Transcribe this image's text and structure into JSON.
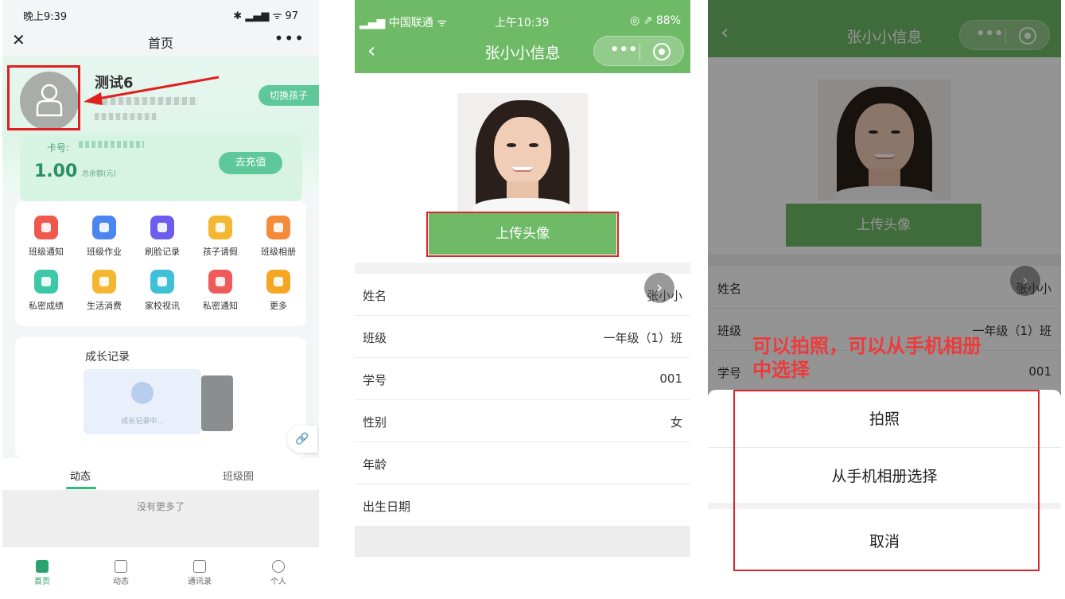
{
  "panel1": {
    "status_time": "晚上9:39",
    "status_right": "✱ ▂▄▆ ᯤ 97",
    "nav_title": "首页",
    "profile_name": "测试6",
    "switch_child": "切换孩子",
    "card_label": "卡号:",
    "balance": "1.00",
    "balance_label": "总余额(元)",
    "recharge": "去充值",
    "features": [
      {
        "label": "班级通知",
        "color": "#f0584e"
      },
      {
        "label": "班级作业",
        "color": "#4b86f0"
      },
      {
        "label": "刷脸记录",
        "color": "#6c5df0"
      },
      {
        "label": "孩子请假",
        "color": "#f5b731"
      },
      {
        "label": "班级相册",
        "color": "#f58a3a"
      },
      {
        "label": "私密成绩",
        "color": "#3dc9a8"
      },
      {
        "label": "生活消费",
        "color": "#f5b731"
      },
      {
        "label": "家校视讯",
        "color": "#3ec0d8"
      },
      {
        "label": "私密通知",
        "color": "#f05a5a"
      },
      {
        "label": "更多",
        "color": "#f5a623"
      }
    ],
    "growth_title": "成长记录",
    "growth_empty": "成长记录中...",
    "tabs": [
      "动态",
      "班级圈"
    ],
    "no_more": "没有更多了",
    "bottom_nav": [
      "首页",
      "动态",
      "通讯录",
      "个人"
    ]
  },
  "panel2": {
    "carrier": "▂▄▆ 中国联通 ᯤ",
    "time": "上午10:39",
    "battery": "◎ ⇗ 88%",
    "title": "张小小信息",
    "upload": "上传头像",
    "rows": [
      {
        "key": "姓名",
        "value": "张小小"
      },
      {
        "key": "班级",
        "value": "一年级（1）班"
      },
      {
        "key": "学号",
        "value": "001"
      },
      {
        "key": "性别",
        "value": "女"
      },
      {
        "key": "年龄",
        "value": ""
      },
      {
        "key": "出生日期",
        "value": ""
      }
    ]
  },
  "panel3": {
    "title": "张小小信息",
    "upload": "上传头像",
    "rows": [
      {
        "key": "姓名",
        "value": "张小小"
      },
      {
        "key": "班级",
        "value": "一年级（1）班"
      },
      {
        "key": "学号",
        "value": "001"
      }
    ],
    "annotation_line1": "可以拍照，可以从手机相册",
    "annotation_line2": "中选择",
    "options": [
      "拍照",
      "从手机相册选择",
      "取消"
    ]
  },
  "colors": {
    "brand_green": "#6fba66",
    "mint": "#5fc89a",
    "annotation_red": "#e02020"
  }
}
